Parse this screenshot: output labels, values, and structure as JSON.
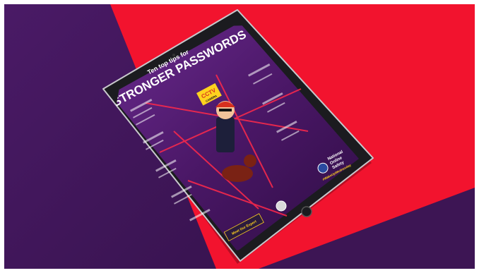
{
  "poster": {
    "heading_small": "Ten top tips for",
    "heading_large": "STRONGER PASSWORDS",
    "badge_top": "CCTV",
    "badge_bottom": "CAMERA",
    "meet_expert": "Meet Our Expert",
    "brand_line1": "National",
    "brand_line2": "Online",
    "brand_line3": "Safety",
    "hashtag": "#WakeUpWednesday"
  },
  "colors": {
    "background_purple": "#3d1554",
    "background_red": "#f2132e",
    "tablet_frame": "#1b1b1f",
    "poster_base": "#5a1f7a",
    "poster_title": "#ffffff",
    "accent_yellow": "#ffd21f"
  }
}
